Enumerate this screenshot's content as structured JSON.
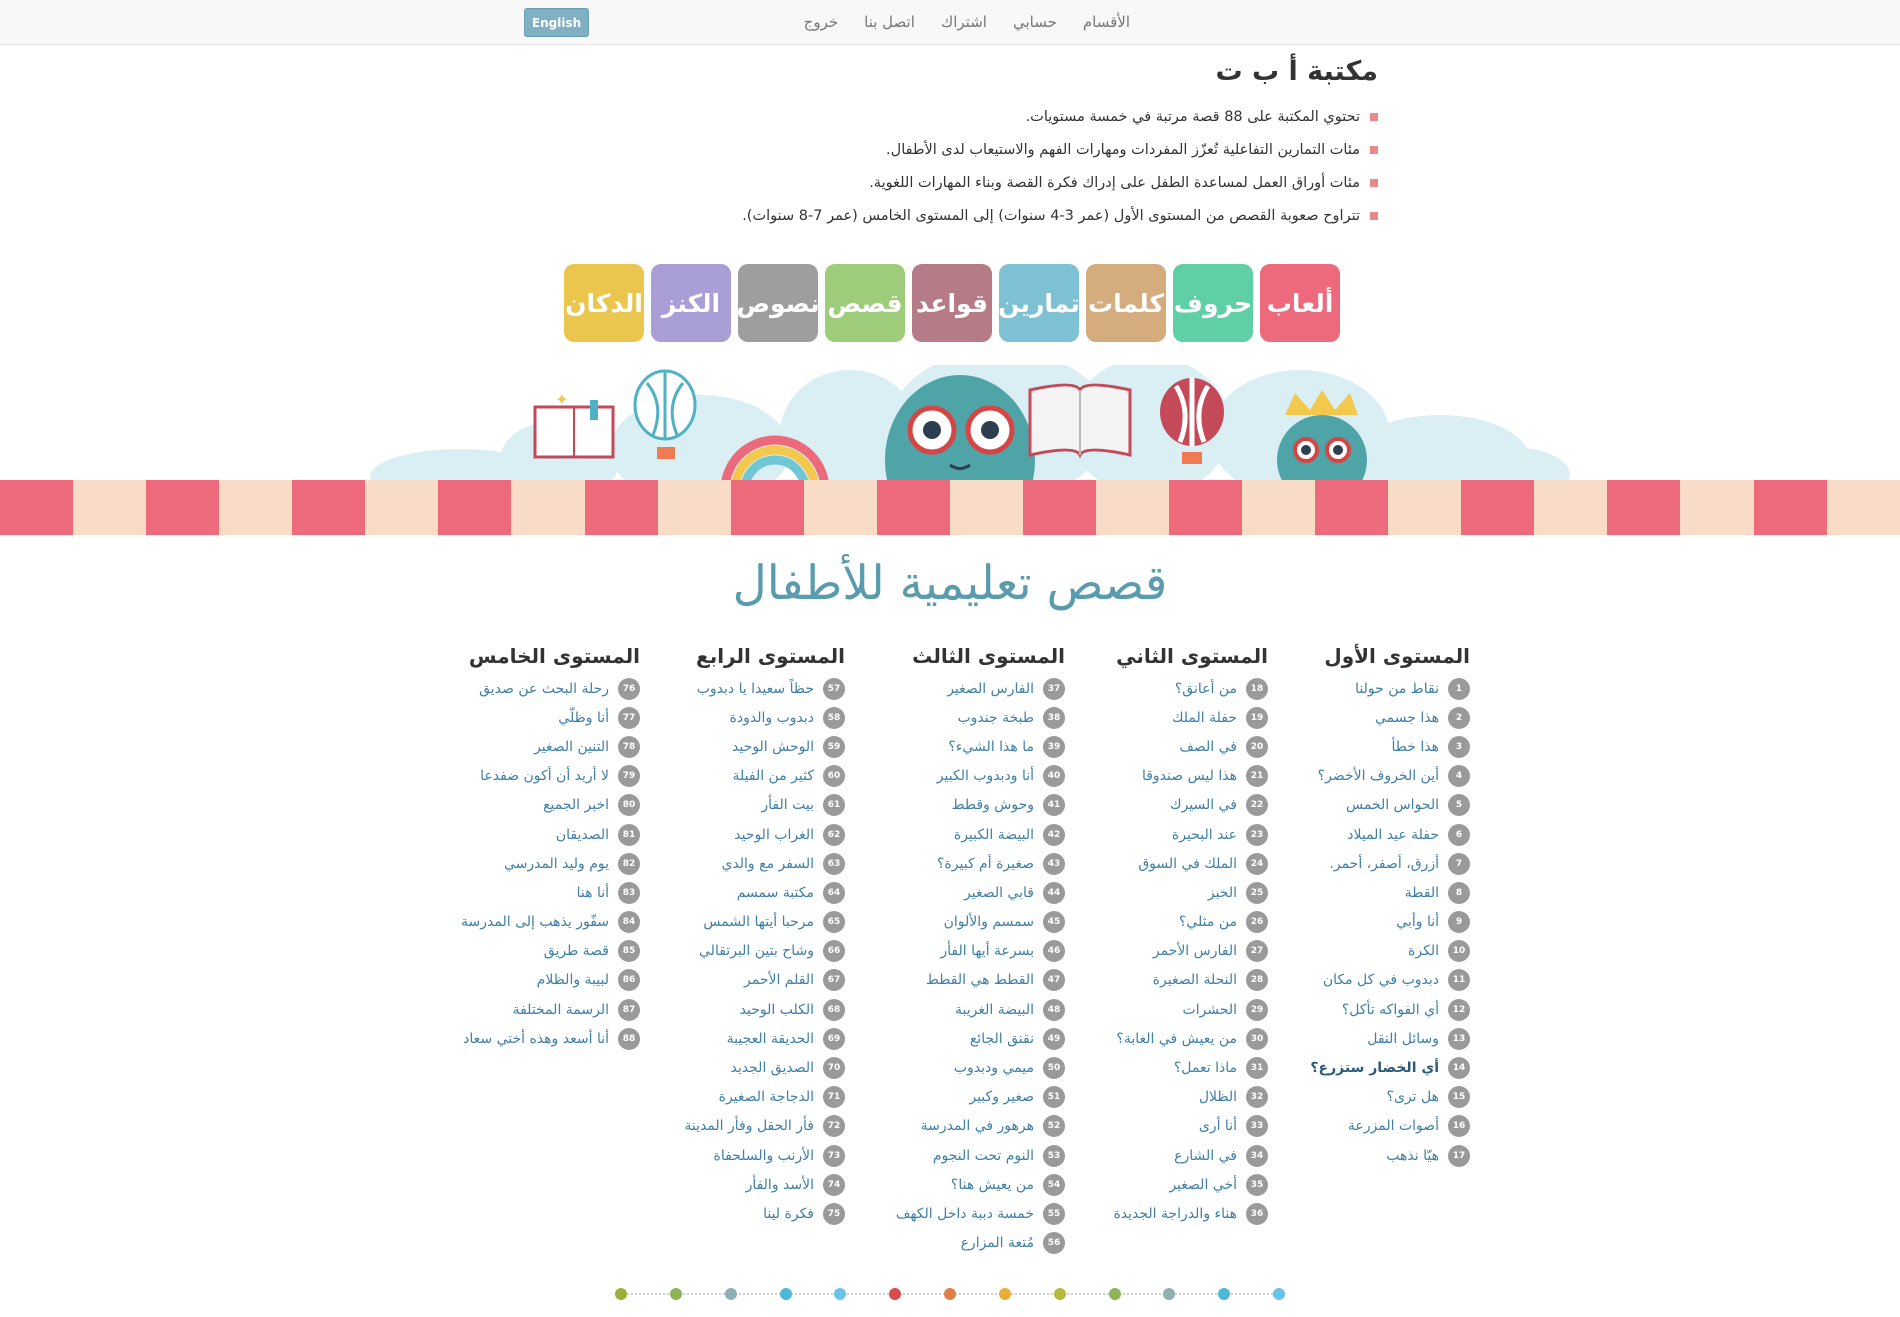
{
  "nav": {
    "links": [
      "الأقسام",
      "حسابي",
      "اشتراك",
      "اتصل بنا",
      "خروج"
    ],
    "lang_button": "English"
  },
  "intro": {
    "title": "مكتبة أ ب ت",
    "bullets": [
      "تحتوي المكتبة على 88 قصة مرتبة في خمسة مستويات.",
      "مئات التمارين التفاعلية تُعزّز المفردات ومهارات الفهم والاستيعاب لدى الأطفال.",
      "مئات أوراق العمل لمساعدة الطفل على إدراك فكرة القصة وبناء المهارات اللغوية.",
      "تتراوح صعوبة القصص من المستوى الأول (عمر 3-4 سنوات) إلى المستوى الخامس (عمر 7-8 سنوات)."
    ]
  },
  "categories": [
    {
      "label": "ألعاب",
      "color": "#ec6a7c"
    },
    {
      "label": "حروف",
      "color": "#5fcfa6"
    },
    {
      "label": "كلمات",
      "color": "#d5ac7d"
    },
    {
      "label": "تمارين",
      "color": "#7ec0d4"
    },
    {
      "label": "قواعد",
      "color": "#b57b86"
    },
    {
      "label": "قصص",
      "color": "#9fcc7a"
    },
    {
      "label": "نصوص",
      "color": "#9e9e9e"
    },
    {
      "label": "الكنز",
      "color": "#a99ed6"
    },
    {
      "label": "الدكان",
      "color": "#ebc64e"
    }
  ],
  "colors": {
    "stripe_pink": "#ec6a7c",
    "stripe_cream": "#f9dcc8",
    "heading": "#5a9bae",
    "link": "#3f7fa6",
    "badge": "#9a9a9a"
  },
  "main_heading": "قصص تعليمية للأطفال",
  "levels": [
    {
      "title": "المستوى الأول",
      "stories": [
        {
          "n": "1",
          "t": "نقاط من حولنا"
        },
        {
          "n": "2",
          "t": "هذا جسمي"
        },
        {
          "n": "3",
          "t": "هذا خطأ"
        },
        {
          "n": "4",
          "t": "أين الخروف الأخضر؟"
        },
        {
          "n": "5",
          "t": "الحواس الخمس"
        },
        {
          "n": "6",
          "t": "حفلة عيد الميلاد"
        },
        {
          "n": "7",
          "t": "أزرق، أصفر، أحمر."
        },
        {
          "n": "8",
          "t": "القطة"
        },
        {
          "n": "9",
          "t": "أنا وأبي"
        },
        {
          "n": "10",
          "t": "الكرة"
        },
        {
          "n": "11",
          "t": "دبدوب في كل مكان"
        },
        {
          "n": "12",
          "t": "أي الفواكه تأكل؟"
        },
        {
          "n": "13",
          "t": "وسائل النقل"
        },
        {
          "n": "14",
          "t": "أي الخضار ستزرع؟"
        },
        {
          "n": "15",
          "t": "هل ترى؟"
        },
        {
          "n": "16",
          "t": "أصوات المزرعة"
        },
        {
          "n": "17",
          "t": "هيّا نذهب"
        }
      ]
    },
    {
      "title": "المستوى الثاني",
      "stories": [
        {
          "n": "18",
          "t": "من أعانق؟"
        },
        {
          "n": "19",
          "t": "حفلة الملك"
        },
        {
          "n": "20",
          "t": "في الصف"
        },
        {
          "n": "21",
          "t": "هذا ليس صندوقا"
        },
        {
          "n": "22",
          "t": "في السيرك"
        },
        {
          "n": "23",
          "t": "عند البحيرة"
        },
        {
          "n": "24",
          "t": "الملك في السوق"
        },
        {
          "n": "25",
          "t": "الخبز"
        },
        {
          "n": "26",
          "t": "من مثلي؟"
        },
        {
          "n": "27",
          "t": "الفارس الأحمر"
        },
        {
          "n": "28",
          "t": "النحلة الصغيرة"
        },
        {
          "n": "29",
          "t": "الحشرات"
        },
        {
          "n": "30",
          "t": "من يعيش في الغابة؟"
        },
        {
          "n": "31",
          "t": "ماذا تعمل؟"
        },
        {
          "n": "32",
          "t": "الظلال"
        },
        {
          "n": "33",
          "t": "أنا أرى"
        },
        {
          "n": "34",
          "t": "في الشارع"
        },
        {
          "n": "35",
          "t": "أخي الصغير"
        },
        {
          "n": "36",
          "t": "هناء والدراجة الجديدة"
        }
      ]
    },
    {
      "title": "المستوى الثالث",
      "stories": [
        {
          "n": "37",
          "t": "الفارس الصغير"
        },
        {
          "n": "38",
          "t": "طبخة جندوب"
        },
        {
          "n": "39",
          "t": "ما هذا الشيء؟"
        },
        {
          "n": "40",
          "t": "أنا ودبدوب الكبير"
        },
        {
          "n": "41",
          "t": "وحوش وقطط"
        },
        {
          "n": "42",
          "t": "البيضة الكبيرة"
        },
        {
          "n": "43",
          "t": "صغيرة أم كبيرة؟"
        },
        {
          "n": "44",
          "t": "قابي الصغير"
        },
        {
          "n": "45",
          "t": "سمسم والألوان"
        },
        {
          "n": "46",
          "t": "بسرعة أيها الفأر"
        },
        {
          "n": "47",
          "t": "القطط هي القطط"
        },
        {
          "n": "48",
          "t": "البيضة الغريبة"
        },
        {
          "n": "49",
          "t": "نقنق الجائع"
        },
        {
          "n": "50",
          "t": "ميمي ودبدوب"
        },
        {
          "n": "51",
          "t": "صغير وكبير"
        },
        {
          "n": "52",
          "t": "هرهور في المدرسة"
        },
        {
          "n": "53",
          "t": "النوم تحت النجوم"
        },
        {
          "n": "54",
          "t": "من يعيش هنا؟"
        },
        {
          "n": "55",
          "t": "خمسة دببة داخل الكهف"
        },
        {
          "n": "56",
          "t": "مُتعة المزارع"
        }
      ]
    },
    {
      "title": "المستوى الرابع",
      "stories": [
        {
          "n": "57",
          "t": "حظاً سعيدا يا دبدوب"
        },
        {
          "n": "58",
          "t": "دبدوب والدودة"
        },
        {
          "n": "59",
          "t": "الوحش الوحيد"
        },
        {
          "n": "60",
          "t": "كثير من الفيلة"
        },
        {
          "n": "61",
          "t": "بيت الفأر"
        },
        {
          "n": "62",
          "t": "الغراب الوحيد"
        },
        {
          "n": "63",
          "t": "السفر مع والدي"
        },
        {
          "n": "64",
          "t": "مكتبة سمسم"
        },
        {
          "n": "65",
          "t": "مرحبا أيتها الشمس"
        },
        {
          "n": "66",
          "t": "وشاح بتين البرتقالي"
        },
        {
          "n": "67",
          "t": "القلم الأحمر"
        },
        {
          "n": "68",
          "t": "الكلب الوحيد"
        },
        {
          "n": "69",
          "t": "الحديقة العجيبة"
        },
        {
          "n": "70",
          "t": "الصديق الجديد"
        },
        {
          "n": "71",
          "t": "الدجاجة الصغيرة"
        },
        {
          "n": "72",
          "t": "فأر الحقل وفأر المدينة"
        },
        {
          "n": "73",
          "t": "الأرنب والسلحفاة"
        },
        {
          "n": "74",
          "t": "الأسد والفأر"
        },
        {
          "n": "75",
          "t": "فكرة لينا"
        }
      ]
    },
    {
      "title": "المستوى الخامس",
      "stories": [
        {
          "n": "76",
          "t": "رحلة البحث عن صديق"
        },
        {
          "n": "77",
          "t": "أنا وظلّي"
        },
        {
          "n": "78",
          "t": "التنين الصغير"
        },
        {
          "n": "79",
          "t": "لا أريد أن أكون ضفدعا"
        },
        {
          "n": "80",
          "t": "اخبر الجميع"
        },
        {
          "n": "81",
          "t": "الصديقان"
        },
        {
          "n": "82",
          "t": "يوم وليد المدرسي"
        },
        {
          "n": "83",
          "t": "أنا هنا"
        },
        {
          "n": "84",
          "t": "سفّور يذهب إلى المدرسة"
        },
        {
          "n": "85",
          "t": "قصة طريق"
        },
        {
          "n": "86",
          "t": "لبيبة والظلام"
        },
        {
          "n": "87",
          "t": "الرسمة المختلفة"
        },
        {
          "n": "88",
          "t": "أنا أسعد وهذه أختي سعاد"
        }
      ]
    }
  ],
  "pagination_dots": [
    "#9bae3a",
    "#8fb357",
    "#8db0b8",
    "#4cbad6",
    "#67c3e8",
    "#d94a4a",
    "#e07f45",
    "#e8ad38",
    "#b8b83b",
    "#8fb357",
    "#8fb0b2",
    "#4cbad6",
    "#67c3e8"
  ]
}
